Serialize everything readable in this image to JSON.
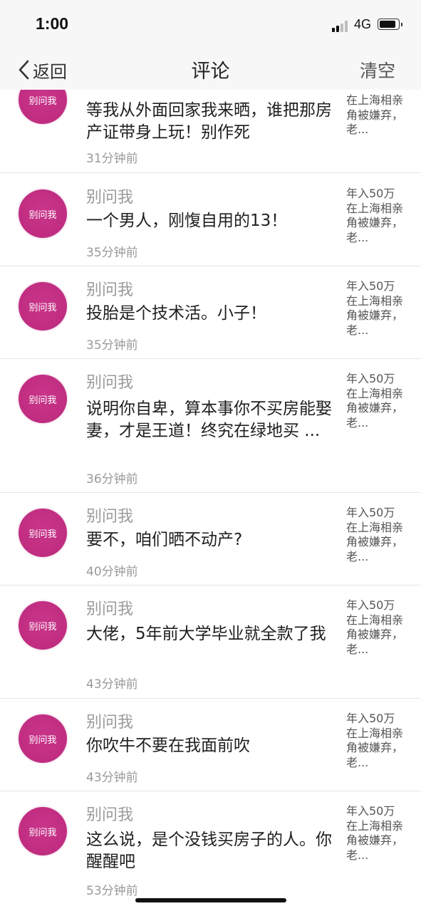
{
  "status": {
    "time": "1:00",
    "network": "4G"
  },
  "nav": {
    "back_label": "返回",
    "title": "评论",
    "clear_label": "清空"
  },
  "avatar_label": "别问我",
  "comments": [
    {
      "username": "",
      "text": "等我从外面回家我来晒，谁把那房产证带身上玩！别作死",
      "time": "31分钟前",
      "article": "在上海相亲角被嫌弃，老..."
    },
    {
      "username": "别问我",
      "text": "一个男人，刚愎自用的13！",
      "time": "35分钟前",
      "article": "年入50万在上海相亲角被嫌弃，老..."
    },
    {
      "username": "别问我",
      "text": "投胎是个技术活。小子！",
      "time": "35分钟前",
      "article": "年入50万在上海相亲角被嫌弃，老..."
    },
    {
      "username": "别问我",
      "text": "说明你自卑，算本事你不买房能娶妻，才是王道！终究在绿地买 ...",
      "time": "36分钟前",
      "article": "年入50万在上海相亲角被嫌弃，老..."
    },
    {
      "username": "别问我",
      "text": "要不，咱们晒不动产?",
      "time": "40分钟前",
      "article": "年入50万在上海相亲角被嫌弃，老..."
    },
    {
      "username": "别问我",
      "text": "大佬，5年前大学毕业就全款了我",
      "time": "43分钟前",
      "article": "年入50万在上海相亲角被嫌弃，老..."
    },
    {
      "username": "别问我",
      "text": "你吹牛不要在我面前吹",
      "time": "43分钟前",
      "article": "年入50万在上海相亲角被嫌弃，老..."
    },
    {
      "username": "别问我",
      "text": "这么说，是个没钱买房子的人。你醒醒吧",
      "time": "53分钟前",
      "article": "年入50万在上海相亲角被嫌弃，老..."
    }
  ]
}
